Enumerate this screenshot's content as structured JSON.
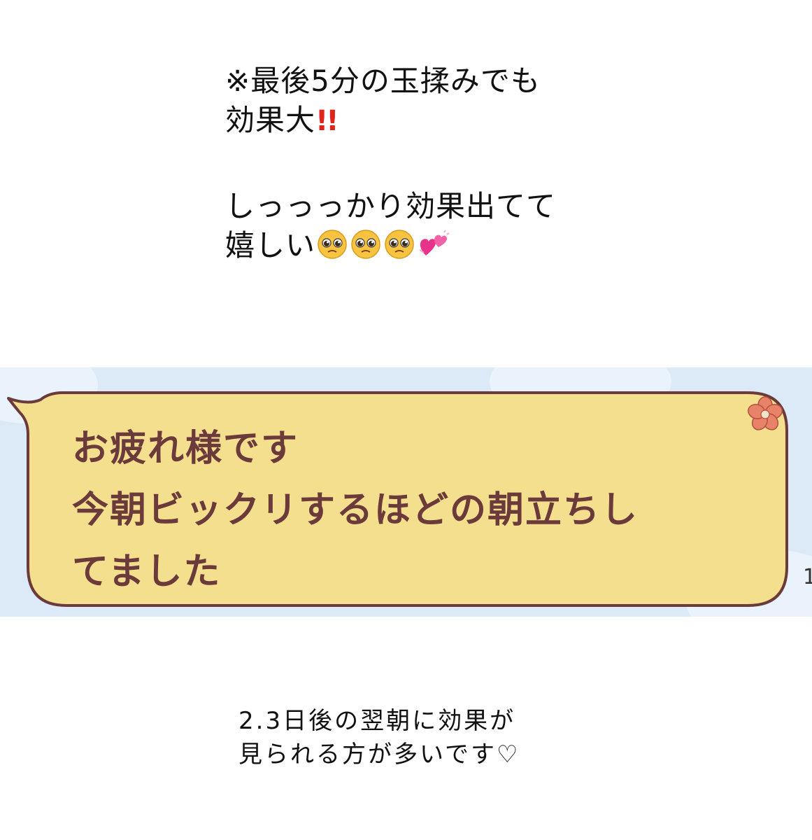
{
  "top_message": {
    "line1": "※最後5分の玉揉みでも",
    "line2_text": "効果大",
    "line2_mark": "!!",
    "line3": "しっっっかり効果出てて",
    "line4_text": "嬉しい"
  },
  "icons": {
    "faces": [
      "pleading-face-icon",
      "pleading-face-icon",
      "pleading-face-icon"
    ],
    "heart": "two-hearts-icon",
    "flower": "hibiscus-icon"
  },
  "chat": {
    "line1": "お疲れ様です",
    "line2": "今朝ビックリするほどの朝立ちし",
    "line3": "てました",
    "side_number": "1",
    "colors": {
      "background": "#dce9f7",
      "bubble": "#f4df8e",
      "border": "#6b3a3a",
      "text": "#6b3a3a"
    }
  },
  "bottom_message": {
    "line1": "2.3日後の翌朝に効果が",
    "line2": "見られる方が多いです♡"
  }
}
